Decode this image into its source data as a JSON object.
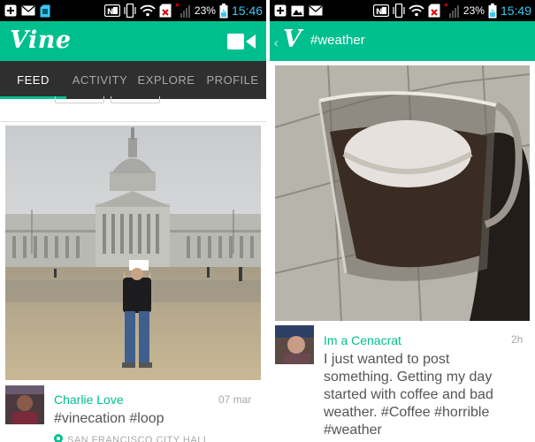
{
  "left_screen": {
    "status_bar": {
      "battery_percent": "23%",
      "clock": "15:46"
    },
    "app_bar": {
      "logo_text": "Vine",
      "camera_icon": "video-camera-icon"
    },
    "tabs": [
      {
        "label": "FEED",
        "active": true
      },
      {
        "label": "ACTIVITY",
        "active": false
      },
      {
        "label": "EXPLORE",
        "active": false
      },
      {
        "label": "PROFILE",
        "active": false
      }
    ],
    "post": {
      "author": "Charlie Love",
      "timestamp": "07 mar",
      "caption": "#vinecation #loop",
      "location": "SAN FRANCISCO CITY HALL"
    }
  },
  "right_screen": {
    "status_bar": {
      "battery_percent": "23%",
      "clock": "15:49"
    },
    "app_bar": {
      "logo_text": "V",
      "title": "#weather",
      "back_icon": "back-chevron-icon"
    },
    "post": {
      "author": "Im a Cenacrat",
      "timestamp": "2h",
      "caption_lines": [
        "I just wanted to post",
        "something. Getting my day",
        "started with coffee and bad",
        "weather. #Coffee #horrible",
        "#weather"
      ]
    }
  },
  "colors": {
    "brand": "#00bf8f",
    "tab_bar": "#2f2f2f",
    "status_bar": "#000000",
    "clock": "#3bc6f0",
    "caption": "#555555",
    "muted": "#a8a8a8"
  }
}
